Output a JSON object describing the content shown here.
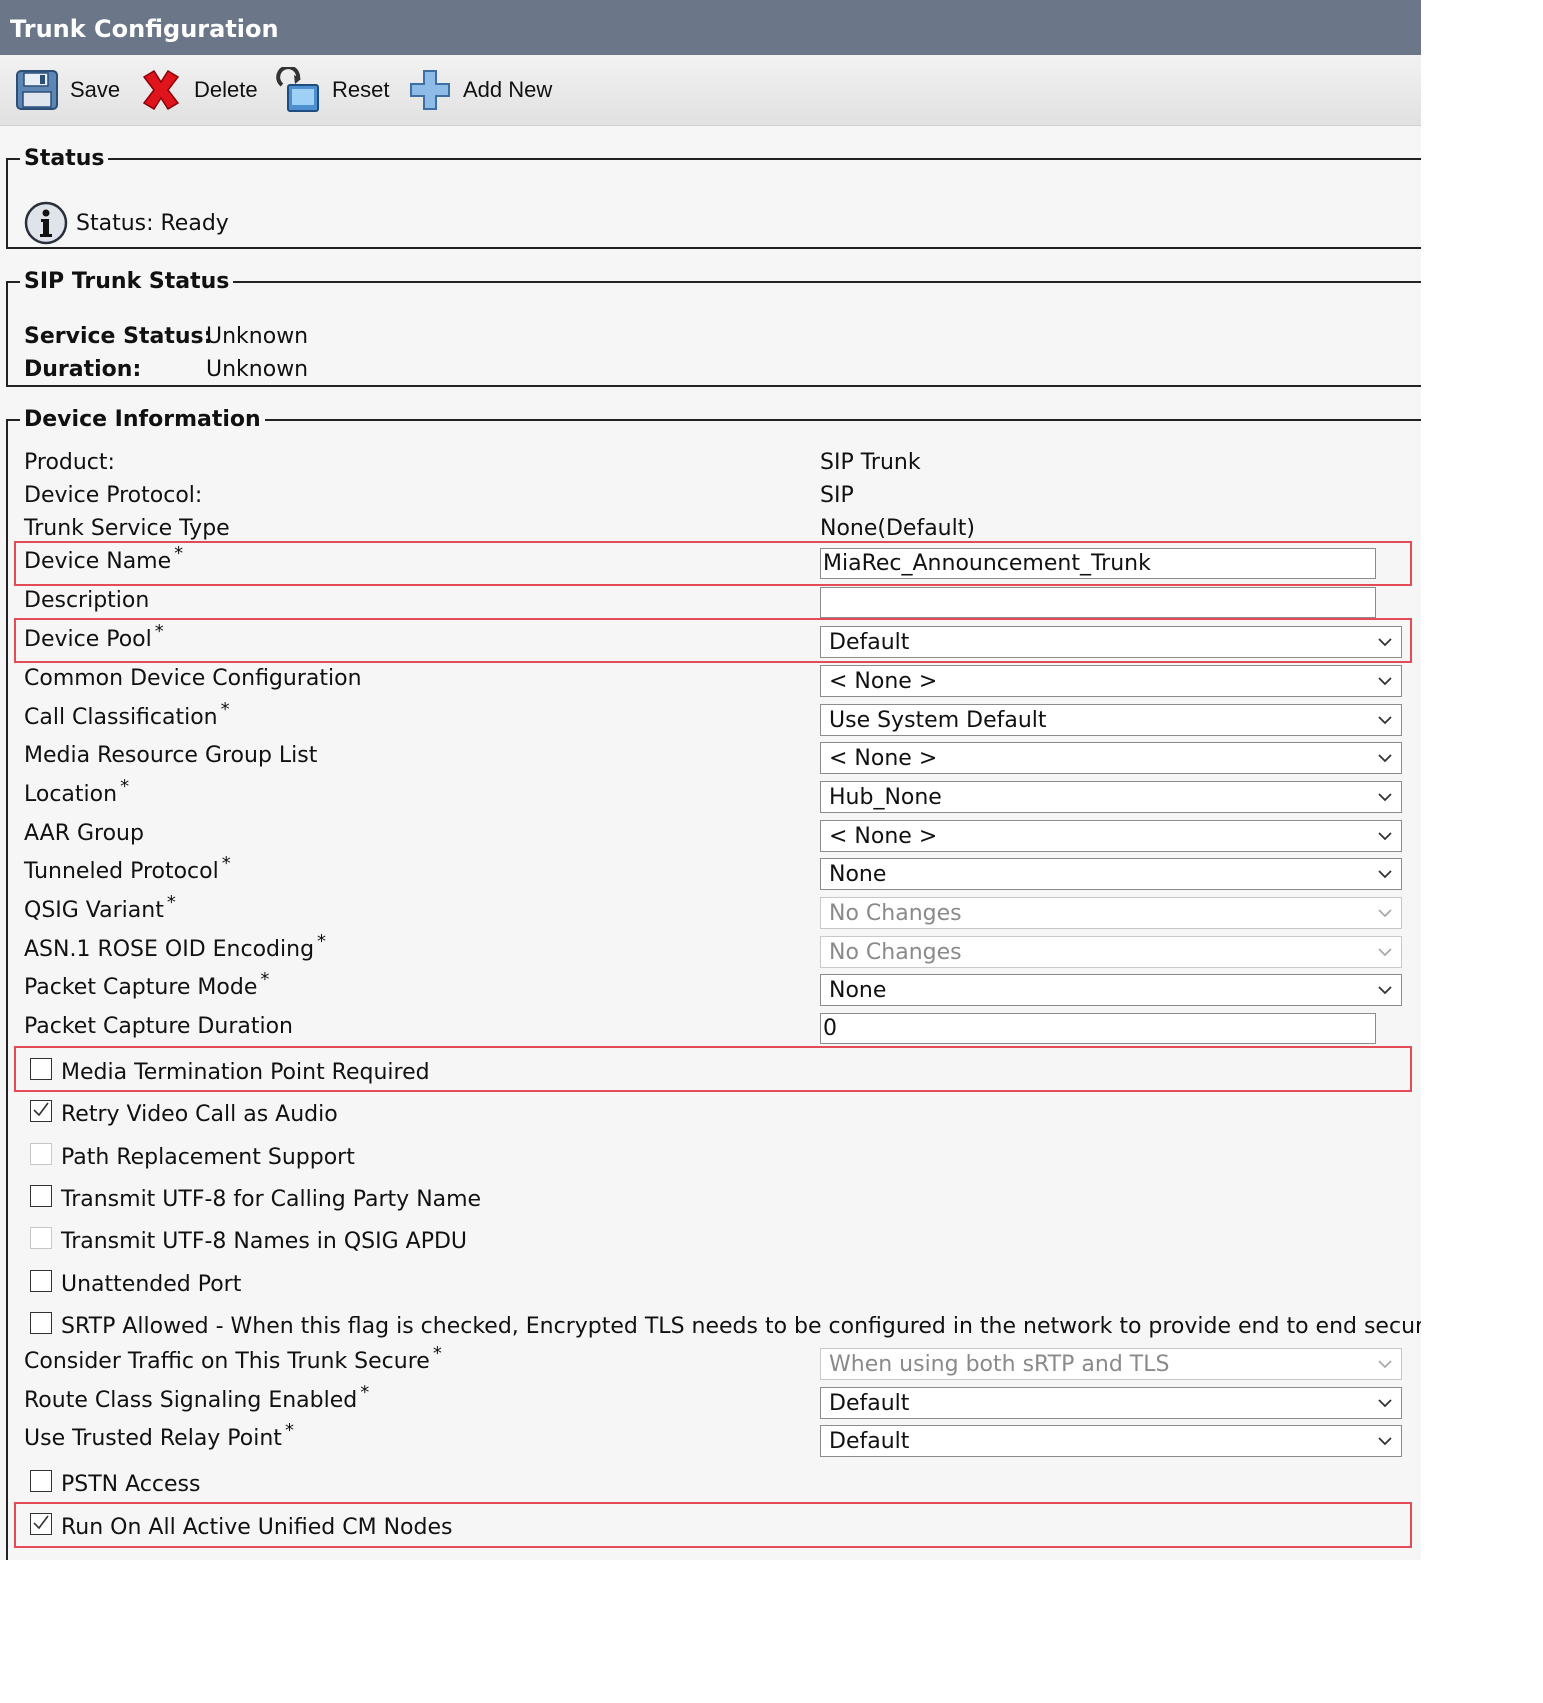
{
  "title": "Trunk Configuration",
  "toolbar": {
    "save": "Save",
    "delete": "Delete",
    "reset": "Reset",
    "add_new": "Add New"
  },
  "status": {
    "legend": "Status",
    "text": "Status: Ready"
  },
  "sip_trunk_status": {
    "legend": "SIP Trunk Status",
    "service_status_label": "Service Status:",
    "service_status_value": "Unknown",
    "duration_label": "Duration:",
    "duration_value": "Unknown"
  },
  "device_info": {
    "legend": "Device Information",
    "product_label": "Product:",
    "product_value": "SIP Trunk",
    "protocol_label": "Device Protocol:",
    "protocol_value": "SIP",
    "service_type_label": "Trunk Service Type",
    "service_type_value": "None(Default)",
    "device_name_label": "Device Name",
    "device_name_value": "MiaRec_Announcement_Trunk",
    "description_label": "Description",
    "description_value": "",
    "device_pool_label": "Device Pool",
    "device_pool_value": "Default",
    "common_device_config_label": "Common Device Configuration",
    "common_device_config_value": "< None >",
    "call_classification_label": "Call Classification",
    "call_classification_value": "Use System Default",
    "mrgl_label": "Media Resource Group List",
    "mrgl_value": "< None >",
    "location_label": "Location",
    "location_value": "Hub_None",
    "aar_group_label": "AAR Group",
    "aar_group_value": "< None >",
    "tunneled_protocol_label": "Tunneled Protocol",
    "tunneled_protocol_value": "None",
    "qsig_variant_label": "QSIG Variant",
    "qsig_variant_value": "No Changes",
    "asn1_label": "ASN.1 ROSE OID Encoding",
    "asn1_value": "No Changes",
    "packet_capture_mode_label": "Packet Capture Mode",
    "packet_capture_mode_value": "None",
    "packet_capture_duration_label": "Packet Capture Duration",
    "packet_capture_duration_value": "0",
    "mtp_required": "Media Termination Point Required",
    "retry_video": "Retry Video Call as Audio",
    "path_replacement": "Path Replacement Support",
    "transmit_utf8_calling": "Transmit UTF-8 for Calling Party Name",
    "transmit_utf8_qsig": "Transmit UTF-8 Names in QSIG APDU",
    "unattended_port": "Unattended Port",
    "srtp_allowed": "SRTP Allowed - When this flag is checked, Encrypted TLS needs to be configured in the network to provide end to end security. Fail",
    "consider_traffic_label": "Consider Traffic on This Trunk Secure",
    "consider_traffic_value": "When using both sRTP and TLS",
    "route_class_label": "Route Class Signaling Enabled",
    "route_class_value": "Default",
    "trusted_relay_label": "Use Trusted Relay Point",
    "trusted_relay_value": "Default",
    "pstn_access": "PSTN Access",
    "run_on_all_nodes": "Run On All Active Unified CM Nodes"
  },
  "required_marker": "*",
  "colors": {
    "titlebar": "#6b7789",
    "highlight": "#e34b57"
  }
}
